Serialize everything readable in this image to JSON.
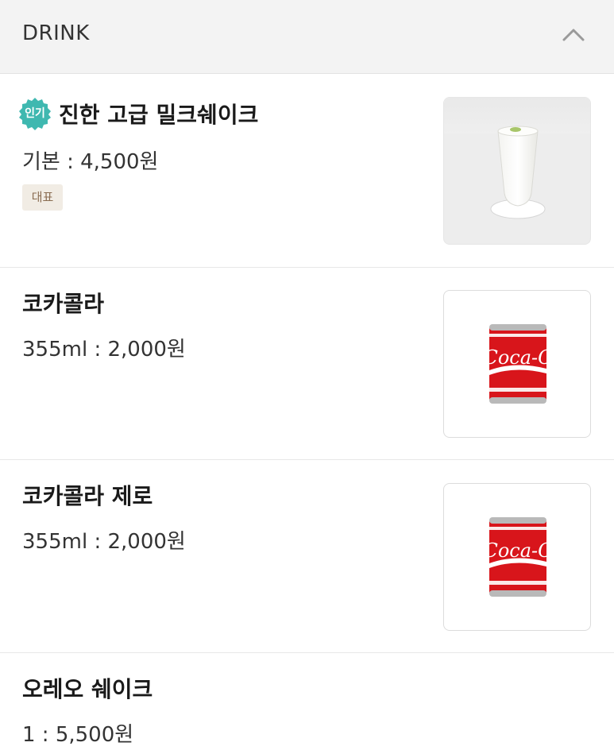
{
  "section": {
    "title": "DRINK",
    "collapse_icon": "chevron-up-icon"
  },
  "items": [
    {
      "name": "진한 고급 밀크쉐이크",
      "price": "기본 : 4,500원",
      "badge": "인기",
      "tag": "대표",
      "image": "milkshake-photo"
    },
    {
      "name": "코카콜라",
      "price": "355ml : 2,000원",
      "image": "coca-cola-can-photo"
    },
    {
      "name": "코카콜라 제로",
      "price": "355ml : 2,000원",
      "image": "coca-cola-can-photo"
    },
    {
      "name": "오레오 쉐이크",
      "price": "1 : 5,500원"
    }
  ],
  "colors": {
    "badge": "#3fb8b0",
    "header_bg": "#f3f3f3",
    "tag_bg": "#f1ece4",
    "tag_text": "#8a6d52",
    "coke_red": "#d8151b"
  }
}
